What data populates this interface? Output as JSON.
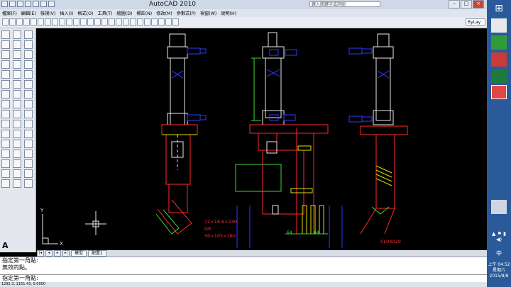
{
  "window": {
    "title": "AutoCAD 2010",
    "search_placeholder": "鍵入關鍵字或詞組"
  },
  "menu": [
    "檔案(F)",
    "編輯(E)",
    "檢視(V)",
    "插入(I)",
    "格式(O)",
    "工具(T)",
    "繪圖(D)",
    "標註(N)",
    "修改(M)",
    "參數式(P)",
    "視窗(W)",
    "說明(H)"
  ],
  "toolbar": {
    "layer_combo": "ByLay"
  },
  "tabs": [
    "模型",
    "配置1"
  ],
  "command": {
    "line1": "指定第一角點:",
    "line2": "無效的點。",
    "prompt": "指定第一角點:"
  },
  "status": {
    "coords": "1292.3, 1151.43, 0.0000"
  },
  "annotations": {
    "note1": "12×18.6×230",
    "note2": "GR",
    "note3": "50×105×180",
    "dim1": "64",
    "dim2": "64",
    "part_no": "CL04029"
  },
  "ucs": {
    "x": "X",
    "y": "Y"
  },
  "clock": {
    "time": "上午 04:52",
    "day": "星期六",
    "date": "2015/8/8"
  },
  "ime": "中",
  "colors": {
    "cad_bg": "#000000",
    "red": "#ff2a2a",
    "blue": "#2e3cff",
    "green": "#33dd33",
    "yellow": "#e0e000",
    "white": "#e8e8e8"
  }
}
